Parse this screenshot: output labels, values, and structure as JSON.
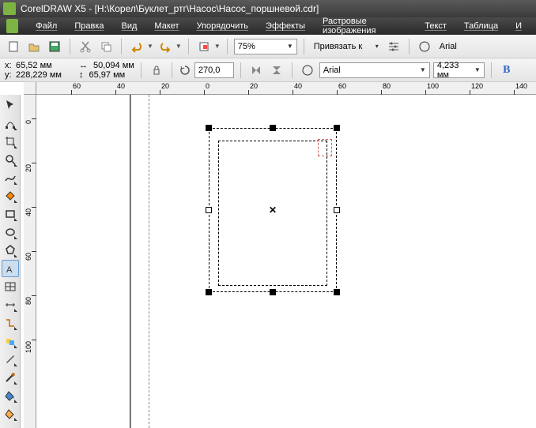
{
  "titlebar": {
    "text": "CorelDRAW X5 - [H:\\Корел\\Буклет_ртг\\Насос\\Насос_поршневой.cdr]"
  },
  "menubar": {
    "items": [
      "Файл",
      "Правка",
      "Вид",
      "Макет",
      "Упорядочить",
      "Эффекты",
      "Растровые изображения",
      "Текст",
      "Таблица",
      "И"
    ]
  },
  "toolbar1": {
    "zoom": "75%",
    "snap_label": "Привязать к",
    "font": "Arial"
  },
  "toolbar2": {
    "coords": {
      "x_label": "x:",
      "x_val": "65,52 мм",
      "y_label": "y:",
      "y_val": "228,229 мм",
      "w_val": "50,094 мм",
      "h_val": "65,97 мм"
    },
    "rotation": "270,0",
    "font": "Arial",
    "font_size": "4,233 мм"
  },
  "ruler_h": [
    "60",
    "40",
    "20",
    "0",
    "20",
    "40",
    "60",
    "80",
    "100",
    "120",
    "140"
  ],
  "ruler_v": [
    "0",
    "20",
    "40",
    "60",
    "80",
    "100"
  ]
}
